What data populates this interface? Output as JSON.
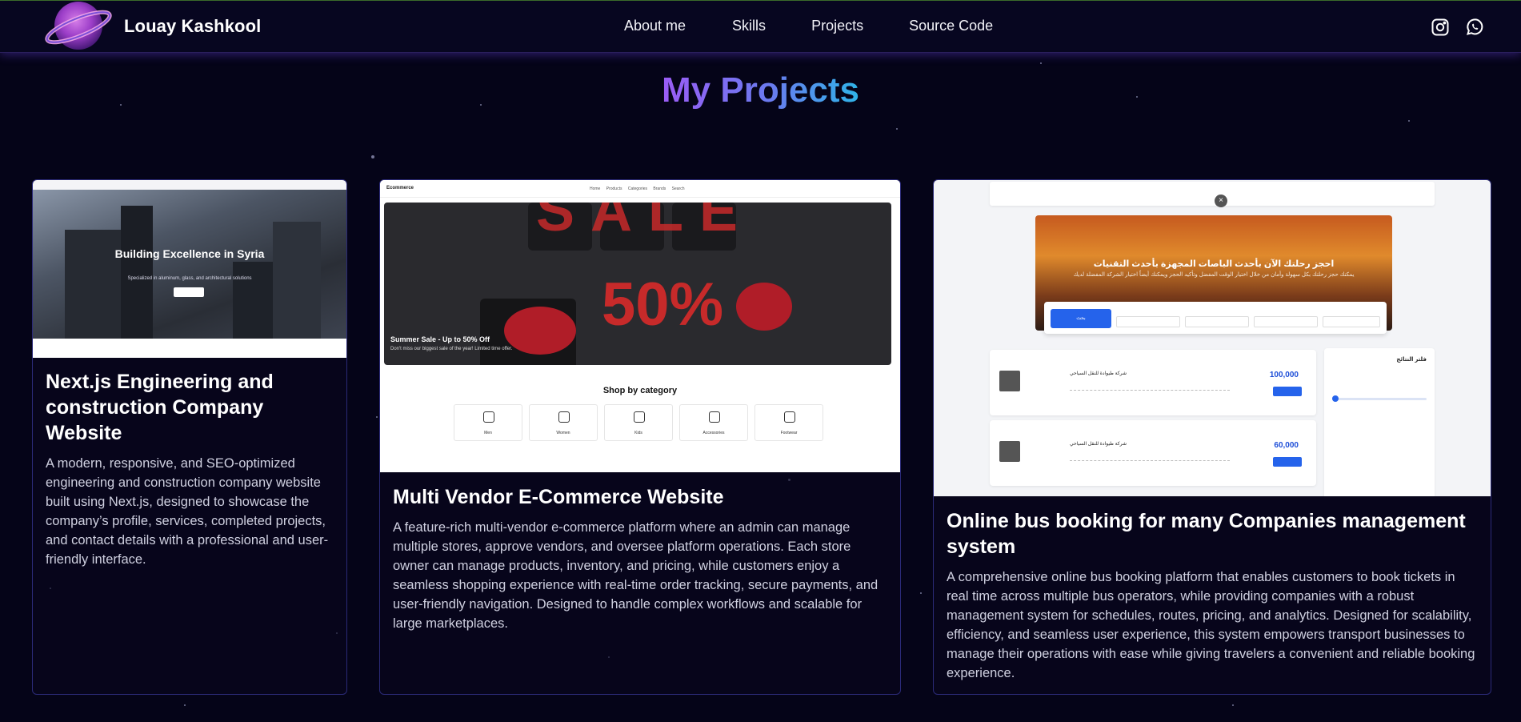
{
  "brand": "Louay Kashkool",
  "nav": {
    "links": [
      "About me",
      "Skills",
      "Projects",
      "Source Code"
    ]
  },
  "social": {
    "icons": [
      "instagram-icon",
      "whatsapp-icon"
    ]
  },
  "section": {
    "title": "My Projects"
  },
  "projects": [
    {
      "title": "Next.js Engineering and construction Company Website",
      "description": "A modern, responsive, and SEO-optimized engineering and construction company website built using Next.js, designed to showcase the company’s profile, services, completed projects, and contact details with a professional and user-friendly interface.",
      "screenshot": {
        "hero_title": "Building Excellence in Syria",
        "hero_sub": "Specialized in aluminum, glass, and architectural solutions"
      }
    },
    {
      "title": "Multi Vendor E-Commerce Website",
      "description": "A feature-rich multi-vendor e-commerce platform where an admin can manage multiple stores, approve vendors, and oversee platform operations. Each store owner can manage products, inventory, and pricing, while customers enjoy a seamless shopping experience with real-time order tracking, secure payments, and user-friendly navigation. Designed to handle complex workflows and scalable for large marketplaces.",
      "screenshot": {
        "brand": "Ecommerce",
        "links": "Home Products Categories Brands Search",
        "sale_word": "SALE",
        "sale_percent": "50%",
        "caption": "Summer Sale - Up to 50% Off",
        "caption_sub": "Don't miss our biggest sale of the year! Limited time offer.",
        "category_title": "Shop by category",
        "categories": [
          "Men",
          "Women",
          "Kids",
          "Accessories",
          "Footwear"
        ]
      }
    },
    {
      "title": "Online bus booking for many Companies management system",
      "description": "A comprehensive online bus booking platform that enables customers to book tickets in real time across multiple bus operators, while providing companies with a robust management system for schedules, routes, pricing, and analytics. Designed for scalability, efficiency, and seamless user experience, this system empowers transport businesses to manage their operations with ease while giving travelers a convenient and reliable booking experience.",
      "screenshot": {
        "hero_title": "احجز رحلتك الآن بأحدث الباصات المجهزة بأحدث التقنيات",
        "hero_sub": "يمكنك حجز رحلتك بكل سهولة وأمان من خلال اختيار الوقت المفضل وتأكيد الحجز ويمكنك أيضاً اختيار الشركة المفضلة لديك",
        "search_label": "بحث",
        "prices": [
          "100,000",
          "60,000"
        ],
        "company": "شركة طيوادة للنقل السياحي",
        "filter_title": "فلتر النتائج"
      }
    }
  ]
}
